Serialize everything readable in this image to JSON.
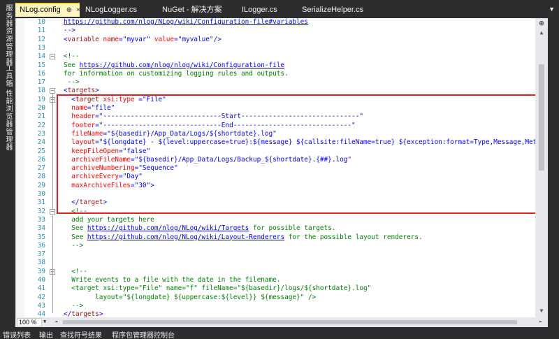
{
  "left_rail": {
    "items": [
      "服务器资源管理器",
      "工具箱",
      "性能浏览器管理器"
    ]
  },
  "tabs": [
    {
      "label": "NLog.config",
      "active": true,
      "pin": "⊕",
      "close": "×"
    },
    {
      "label": "NLogLogger.cs",
      "active": false
    },
    {
      "label": "NuGet - 解决方案",
      "active": false
    },
    {
      "label": "ILogger.cs",
      "active": false
    },
    {
      "label": "SerializeHelper.cs",
      "active": false
    }
  ],
  "tab_overflow_icon": "▼",
  "editor": {
    "lines": [
      {
        "n": "10",
        "tokens": [
          {
            "t": "https://github.com/nlog/NLog/wiki/Configuration-file#variables",
            "c": "c-link"
          }
        ]
      },
      {
        "n": "11",
        "tokens": [
          {
            "t": "-->",
            "c": "c-blue"
          }
        ]
      },
      {
        "n": "12",
        "tokens": [
          {
            "t": "<",
            "c": "c-blue"
          },
          {
            "t": "variable",
            "c": "c-brown"
          },
          {
            "t": " name",
            "c": "c-red"
          },
          {
            "t": "=\"",
            "c": "c-blue"
          },
          {
            "t": "myvar",
            "c": "c-blue"
          },
          {
            "t": "\"",
            "c": "c-blue"
          },
          {
            "t": " value",
            "c": "c-red"
          },
          {
            "t": "=\"",
            "c": "c-blue"
          },
          {
            "t": "myvalue",
            "c": "c-blue"
          },
          {
            "t": "\"/>",
            "c": "c-blue"
          }
        ]
      },
      {
        "n": "13",
        "tokens": []
      },
      {
        "n": "14",
        "fold": "−",
        "tokens": [
          {
            "t": "<!--",
            "c": "c-green"
          }
        ]
      },
      {
        "n": "15",
        "tokens": [
          {
            "t": "See ",
            "c": "c-green"
          },
          {
            "t": "https://github.com/nlog/nlog/wiki/Configuration-file",
            "c": "c-link"
          }
        ]
      },
      {
        "n": "16",
        "tokens": [
          {
            "t": "for information on customizing logging rules and outputs.",
            "c": "c-green"
          }
        ]
      },
      {
        "n": "17",
        "tokens": [
          {
            "t": " -->",
            "c": "c-green"
          }
        ]
      },
      {
        "n": "18",
        "fold": "−",
        "tokens": [
          {
            "t": "<",
            "c": "c-blue"
          },
          {
            "t": "targets",
            "c": "c-brown"
          },
          {
            "t": ">",
            "c": "c-blue"
          }
        ]
      },
      {
        "n": "19",
        "fold": "−",
        "tokens": [
          {
            "t": "  <",
            "c": "c-blue"
          },
          {
            "t": "target",
            "c": "c-brown"
          },
          {
            "t": " xsi:type",
            "c": "c-red"
          },
          {
            "t": " =\"",
            "c": "c-blue"
          },
          {
            "t": "File",
            "c": "c-blue"
          },
          {
            "t": "\"",
            "c": "c-blue"
          }
        ]
      },
      {
        "n": "20",
        "tokens": [
          {
            "t": "  name",
            "c": "c-red"
          },
          {
            "t": "=\"",
            "c": "c-blue"
          },
          {
            "t": "file",
            "c": "c-blue"
          },
          {
            "t": "\"",
            "c": "c-blue"
          }
        ]
      },
      {
        "n": "21",
        "tokens": [
          {
            "t": "  header",
            "c": "c-red"
          },
          {
            "t": "=\"",
            "c": "c-blue"
          },
          {
            "t": "------------------------------Start------------------------------",
            "c": "c-blue"
          },
          {
            "t": "\"",
            "c": "c-blue"
          }
        ]
      },
      {
        "n": "22",
        "tokens": [
          {
            "t": "  footer",
            "c": "c-red"
          },
          {
            "t": "=\"",
            "c": "c-blue"
          },
          {
            "t": "------------------------------End------------------------------",
            "c": "c-blue"
          },
          {
            "t": "\"",
            "c": "c-blue"
          }
        ]
      },
      {
        "n": "23",
        "tokens": [
          {
            "t": "  fileName",
            "c": "c-red"
          },
          {
            "t": "=\"",
            "c": "c-blue"
          },
          {
            "t": "${basedir}/App_Data/Logs/${shortdate}.log",
            "c": "c-blue"
          },
          {
            "t": "\"",
            "c": "c-blue"
          }
        ]
      },
      {
        "n": "24",
        "tokens": [
          {
            "t": "  layout",
            "c": "c-red"
          },
          {
            "t": "=\"",
            "c": "c-blue"
          },
          {
            "t": "${longdate} - ${level:uppercase=true}:${message} ${callsite:fileName=true} ${exception:format=Type,Message,Method,S",
            "c": "c-blue"
          }
        ]
      },
      {
        "n": "25",
        "tokens": [
          {
            "t": "  keepFileOpen",
            "c": "c-red"
          },
          {
            "t": "=\"",
            "c": "c-blue"
          },
          {
            "t": "false",
            "c": "c-blue"
          },
          {
            "t": "\"",
            "c": "c-blue"
          }
        ]
      },
      {
        "n": "26",
        "tokens": [
          {
            "t": "  archiveFileName",
            "c": "c-red"
          },
          {
            "t": "=\"",
            "c": "c-blue"
          },
          {
            "t": "${basedir}/App_Data/Logs/Backup_${shortdate}.{##}.log",
            "c": "c-blue"
          },
          {
            "t": "\"",
            "c": "c-blue"
          }
        ]
      },
      {
        "n": "27",
        "tokens": [
          {
            "t": "  archiveNumbering",
            "c": "c-red"
          },
          {
            "t": "=\"",
            "c": "c-blue"
          },
          {
            "t": "Sequence",
            "c": "c-blue"
          },
          {
            "t": "\"",
            "c": "c-blue"
          }
        ]
      },
      {
        "n": "28",
        "tokens": [
          {
            "t": "  archiveEvery",
            "c": "c-red"
          },
          {
            "t": "=\"",
            "c": "c-blue"
          },
          {
            "t": "Day",
            "c": "c-blue"
          },
          {
            "t": "\"",
            "c": "c-blue"
          }
        ]
      },
      {
        "n": "29",
        "tokens": [
          {
            "t": "  maxArchiveFiles",
            "c": "c-red"
          },
          {
            "t": "=\"",
            "c": "c-blue"
          },
          {
            "t": "30",
            "c": "c-blue"
          },
          {
            "t": "\">",
            "c": "c-blue"
          }
        ]
      },
      {
        "n": "30",
        "tokens": []
      },
      {
        "n": "31",
        "tokens": [
          {
            "t": "  </",
            "c": "c-blue"
          },
          {
            "t": "target",
            "c": "c-brown"
          },
          {
            "t": ">",
            "c": "c-blue"
          }
        ]
      },
      {
        "n": "32",
        "fold": "−",
        "tokens": [
          {
            "t": "  <!--",
            "c": "c-green"
          }
        ]
      },
      {
        "n": "33",
        "tokens": [
          {
            "t": "  add your targets here",
            "c": "c-green"
          }
        ]
      },
      {
        "n": "34",
        "tokens": [
          {
            "t": "  See ",
            "c": "c-green"
          },
          {
            "t": "https://github.com/nlog/NLog/wiki/Targets",
            "c": "c-link"
          },
          {
            "t": " for possible targets.",
            "c": "c-green"
          }
        ]
      },
      {
        "n": "35",
        "tokens": [
          {
            "t": "  See ",
            "c": "c-green"
          },
          {
            "t": "https://github.com/nlog/NLog/wiki/Layout-Renderers",
            "c": "c-link"
          },
          {
            "t": " for the possible layout renderers.",
            "c": "c-green"
          }
        ]
      },
      {
        "n": "36",
        "tokens": [
          {
            "t": "  -->",
            "c": "c-green"
          }
        ]
      },
      {
        "n": "37",
        "tokens": []
      },
      {
        "n": "38",
        "tokens": []
      },
      {
        "n": "39",
        "fold": "−",
        "tokens": [
          {
            "t": "  <!--",
            "c": "c-green"
          }
        ]
      },
      {
        "n": "40",
        "tokens": [
          {
            "t": "  Write events to a file with the date in the filename.",
            "c": "c-green"
          }
        ]
      },
      {
        "n": "41",
        "tokens": [
          {
            "t": "  <target xsi:type=\"File\" name=\"f\" fileName=\"${basedir}/logs/${shortdate}.log\"",
            "c": "c-green"
          }
        ]
      },
      {
        "n": "42",
        "tokens": [
          {
            "t": "        layout=\"${longdate} ${uppercase:${level}} ${message}\" />",
            "c": "c-green"
          }
        ]
      },
      {
        "n": "43",
        "tokens": [
          {
            "t": "  -->",
            "c": "c-green"
          }
        ]
      },
      {
        "n": "44",
        "tokens": [
          {
            "t": "</",
            "c": "c-blue"
          },
          {
            "t": "targets",
            "c": "c-brown"
          },
          {
            "t": ">",
            "c": "c-blue"
          }
        ]
      }
    ]
  },
  "scrollbar": {
    "split_icon": "⊕",
    "up_icon": "▲",
    "down_icon": "▼"
  },
  "zoom": {
    "value": "100 %",
    "caret": "▼"
  },
  "hscroll": {
    "left_icon": "◄",
    "right_icon": "►"
  },
  "bottom_tabs": [
    "错误列表",
    "输出",
    "查找符号结果",
    "程序包管理器控制台"
  ]
}
